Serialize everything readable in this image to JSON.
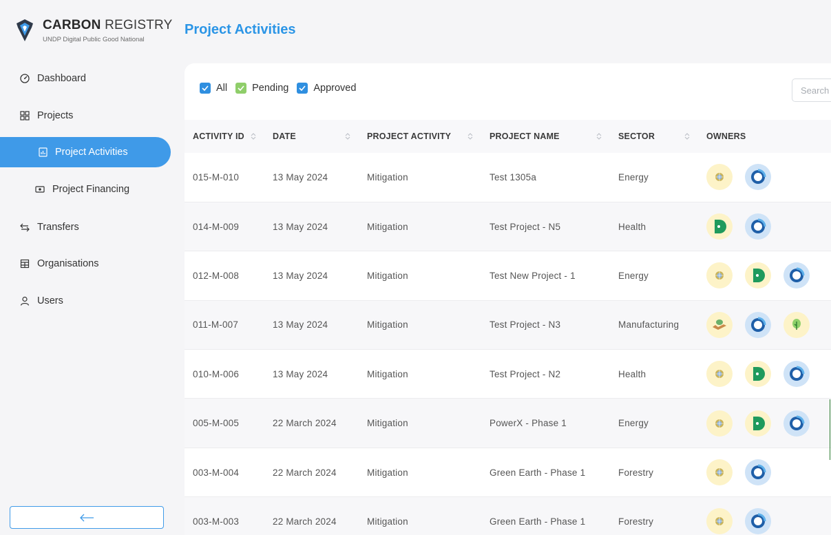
{
  "brand": {
    "name_bold": "CARBON",
    "name_rest": " REGISTRY",
    "tagline": "UNDP Digital Public Good National"
  },
  "sidebar": {
    "items": [
      {
        "label": "Dashboard",
        "icon": "dashboard-icon"
      },
      {
        "label": "Projects",
        "icon": "grid-icon"
      },
      {
        "label": "Project Activities",
        "icon": "report-icon",
        "active": true
      },
      {
        "label": "Project Financing",
        "icon": "money-icon"
      },
      {
        "label": "Transfers",
        "icon": "transfer-icon"
      },
      {
        "label": "Organisations",
        "icon": "building-icon"
      },
      {
        "label": "Users",
        "icon": "user-icon"
      }
    ],
    "collapse_icon": "arrow-left-icon"
  },
  "header": {
    "title": "Project Activities"
  },
  "filters": {
    "all": {
      "label": "All",
      "checked": true
    },
    "pending": {
      "label": "Pending",
      "checked": true,
      "color": "#8fce6a"
    },
    "approved": {
      "label": "Approved",
      "checked": true,
      "color": "#2f8fe0"
    }
  },
  "search": {
    "placeholder": "Search"
  },
  "table": {
    "columns": [
      "ACTIVITY ID",
      "DATE",
      "PROJECT ACTIVITY",
      "PROJECT NAME",
      "SECTOR",
      "OWNERS"
    ],
    "rows": [
      {
        "id": "015-M-010",
        "date": "13 May 2024",
        "activity": "Mitigation",
        "project": "Test 1305a",
        "sector": "Energy",
        "owners": [
          "globe",
          "ring"
        ]
      },
      {
        "id": "014-M-009",
        "date": "13 May 2024",
        "activity": "Mitigation",
        "project": "Test Project - N5",
        "sector": "Health",
        "owners": [
          "d",
          "ring"
        ]
      },
      {
        "id": "012-M-008",
        "date": "13 May 2024",
        "activity": "Mitigation",
        "project": "Test New Project - 1",
        "sector": "Energy",
        "owners": [
          "globe",
          "d",
          "ring"
        ]
      },
      {
        "id": "011-M-007",
        "date": "13 May 2024",
        "activity": "Mitigation",
        "project": "Test Project - N3",
        "sector": "Manufacturing",
        "owners": [
          "hand",
          "ring",
          "plant"
        ]
      },
      {
        "id": "010-M-006",
        "date": "13 May 2024",
        "activity": "Mitigation",
        "project": "Test Project - N2",
        "sector": "Health",
        "owners": [
          "globe",
          "d",
          "ring"
        ]
      },
      {
        "id": "005-M-005",
        "date": "22 March 2024",
        "activity": "Mitigation",
        "project": "PowerX - Phase 1",
        "sector": "Energy",
        "owners": [
          "globe",
          "d",
          "ring"
        ]
      },
      {
        "id": "003-M-004",
        "date": "22 March 2024",
        "activity": "Mitigation",
        "project": "Green Earth - Phase 1",
        "sector": "Forestry",
        "owners": [
          "globe",
          "ring"
        ]
      },
      {
        "id": "003-M-003",
        "date": "22 March 2024",
        "activity": "Mitigation",
        "project": "Green Earth - Phase 1",
        "sector": "Forestry",
        "owners": [
          "globe",
          "ring"
        ]
      }
    ]
  },
  "colors": {
    "accent": "#3f9ae8",
    "title": "#2b95e6"
  }
}
